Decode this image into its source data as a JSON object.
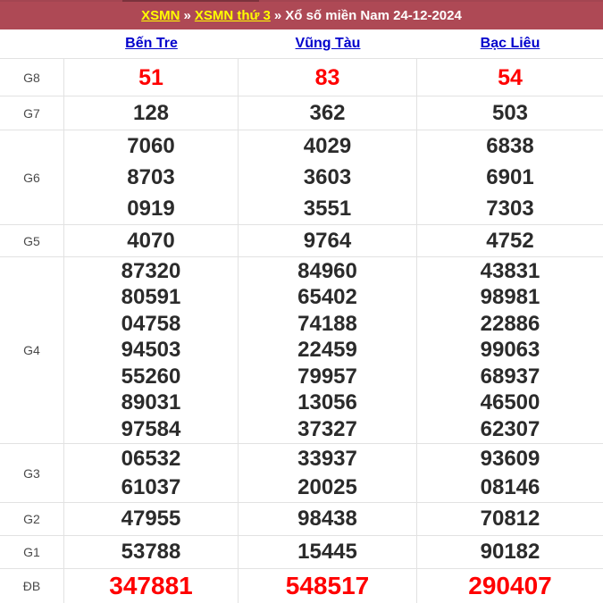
{
  "breadcrumb": {
    "link_xsmn": "XSMN",
    "separator": "»",
    "link_day": "XSMN thứ 3",
    "title": "Xổ số miền Nam 24-12-2024"
  },
  "table": {
    "columns": [
      "Bến Tre",
      "Vũng Tàu",
      "Bạc Liêu"
    ],
    "rows": [
      {
        "label": "G8",
        "values": [
          [
            "51"
          ],
          [
            "83"
          ],
          [
            "54"
          ]
        ]
      },
      {
        "label": "G7",
        "values": [
          [
            "128"
          ],
          [
            "362"
          ],
          [
            "503"
          ]
        ]
      },
      {
        "label": "G6",
        "values": [
          [
            "7060",
            "8703",
            "0919"
          ],
          [
            "4029",
            "3603",
            "3551"
          ],
          [
            "6838",
            "6901",
            "7303"
          ]
        ]
      },
      {
        "label": "G5",
        "values": [
          [
            "4070"
          ],
          [
            "9764"
          ],
          [
            "4752"
          ]
        ]
      },
      {
        "label": "G4",
        "values": [
          [
            "87320",
            "80591",
            "04758",
            "94503",
            "55260",
            "89031",
            "97584"
          ],
          [
            "84960",
            "65402",
            "74188",
            "22459",
            "79957",
            "13056",
            "37327"
          ],
          [
            "43831",
            "98981",
            "22886",
            "99063",
            "68937",
            "46500",
            "62307"
          ]
        ]
      },
      {
        "label": "G3",
        "values": [
          [
            "06532",
            "61037"
          ],
          [
            "33937",
            "20025"
          ],
          [
            "93609",
            "08146"
          ]
        ]
      },
      {
        "label": "G2",
        "values": [
          [
            "47955"
          ],
          [
            "98438"
          ],
          [
            "70812"
          ]
        ]
      },
      {
        "label": "G1",
        "values": [
          [
            "53788"
          ],
          [
            "15445"
          ],
          [
            "90182"
          ]
        ]
      },
      {
        "label": "ĐB",
        "values": [
          [
            "347881"
          ],
          [
            "548517"
          ],
          [
            "290407"
          ]
        ]
      }
    ]
  },
  "colors": {
    "header_bg": "#ae4955",
    "link_yellow": "#ffff00",
    "link_blue": "#0000cc",
    "highlight_red": "#ff0000",
    "number_dark": "#2b2b2b",
    "border": "#e2e2e2"
  }
}
